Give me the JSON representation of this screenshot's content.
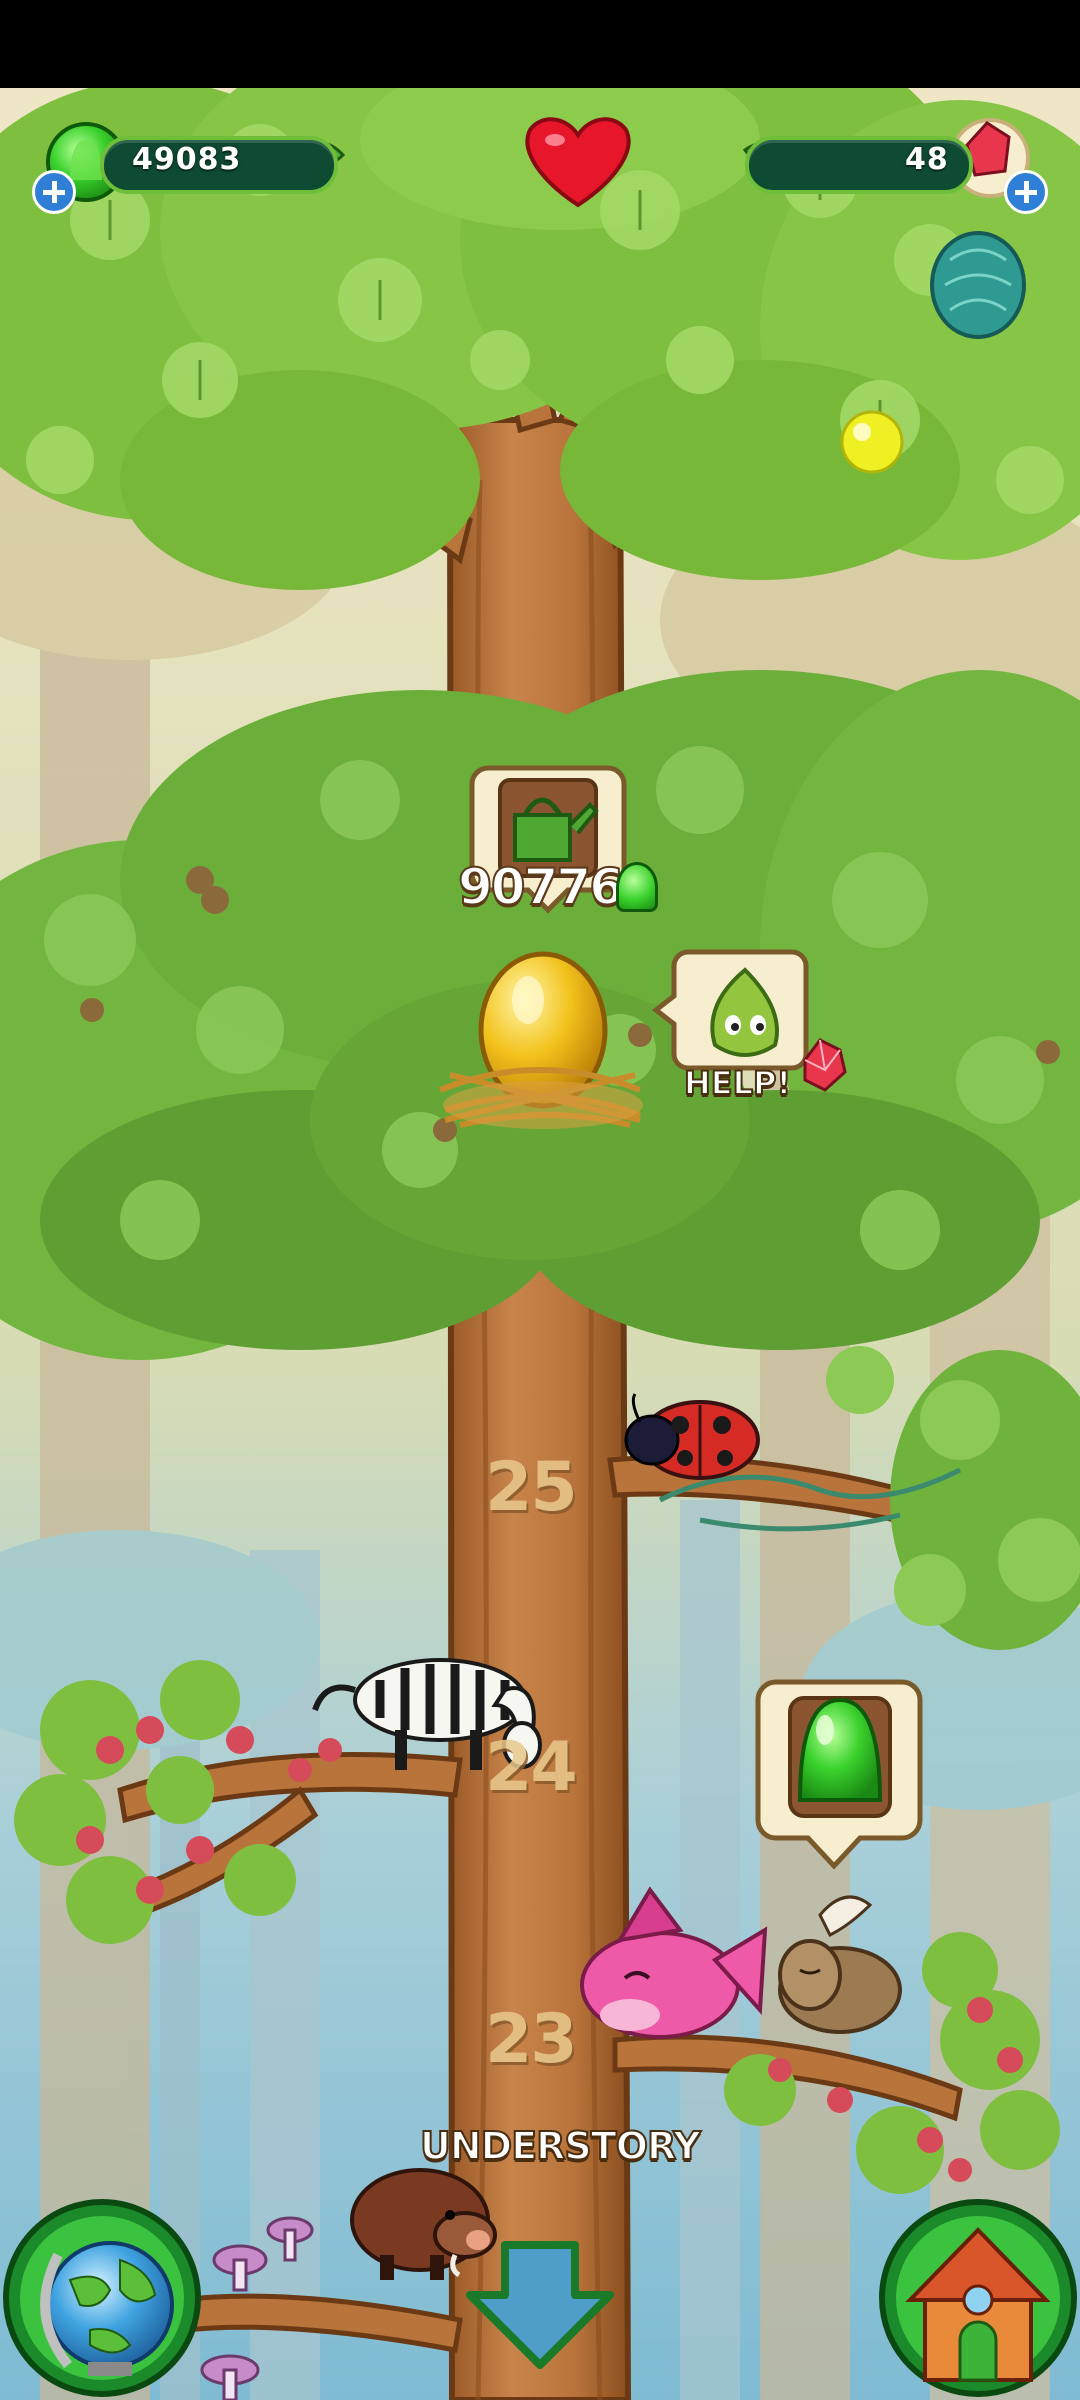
{
  "hud": {
    "gems_count": "49083",
    "crystals_count": "48",
    "add_gems_icon": "plus-icon",
    "add_crystals_icon": "plus-icon",
    "lives_icon": "heart-icon"
  },
  "tree": {
    "levels": [
      {
        "number": "25"
      },
      {
        "number": "24"
      },
      {
        "number": "23"
      }
    ],
    "watering_cost": "90776",
    "help_label": "HELP!",
    "section_label": "UNDERSTORY"
  },
  "nav": {
    "world_icon": "globe-icon",
    "home_icon": "house-icon",
    "down_icon": "arrow-down-icon"
  },
  "colors": {
    "gem_green": "#3ad12c",
    "crystal_red": "#e8364d",
    "heart_red": "#e8162b",
    "trunk": "#b9743c",
    "leaf": "#7fbf3f"
  }
}
